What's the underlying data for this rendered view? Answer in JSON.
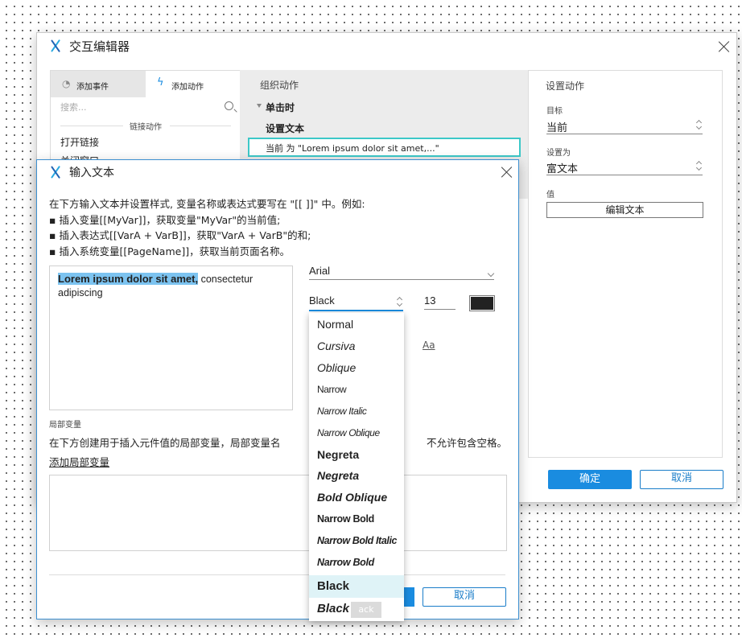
{
  "interaction_editor": {
    "title": "交互编辑器",
    "tab_add_event": "添加事件",
    "tab_add_action": "添加动作",
    "search_placeholder": "搜索...",
    "link_actions_header": "链接动作",
    "link_item_open": "打开链接",
    "link_item_close": "关闭窗口",
    "organize_header": "组织动作",
    "event_click": "单击时",
    "action_set_text": "设置文本",
    "action_detail": "当前 为 \"Lorem ipsum dolor sit amet,...\"",
    "config_header": "设置动作",
    "target_label": "目标",
    "target_value": "当前",
    "setas_label": "设置为",
    "setas_value": "富文本",
    "value_label": "值",
    "edit_text_button": "编辑文本",
    "ok_button": "确定",
    "cancel_button": "取消"
  },
  "input_text_dialog": {
    "title": "输入文本",
    "instructions": [
      "在下方输入文本并设置样式, 变量名称或表达式要写在 \"[[ ]]\" 中。例如:",
      "▪ 插入变量[[MyVar]]，获取变量\"MyVar\"的当前值;",
      "▪ 插入表达式[[VarA + VarB]]，获取\"VarA + VarB\"的和;",
      "▪ 插入系统变量[[PageName]]，获取当前页面名称。"
    ],
    "editor_selected_text": "Lorem ipsum dolor sit amet,",
    "editor_rest_text": " consectetur adipiscing",
    "font_family": "Arial",
    "font_weight": "Black",
    "font_size": "13",
    "text_color": "#222222",
    "format_icon_label": "Aa",
    "local_vars_label": "局部变量",
    "local_vars_desc_left": "在下方创建用于插入元件值的局部变量，局部变量名",
    "local_vars_desc_right": "不允许包含空格。",
    "add_local_var_link": "添加局部变量",
    "cancel_button": "取消",
    "hidden_ok_fragment": "ack"
  },
  "weight_dropdown": {
    "options": [
      "Normal",
      "Cursiva",
      "Oblique",
      "Narrow",
      "Narrow Italic",
      "Narrow Oblique",
      "Negreta",
      "Negreta",
      "Bold Oblique",
      "Narrow Bold",
      "Narrow Bold Italic",
      "Narrow Bold",
      "Black",
      "Black"
    ],
    "selected_index": 12
  },
  "colors": {
    "accent": "#1a8ce0",
    "selection_highlight": "#7cc3f0",
    "active_action_border": "#3cc8c8",
    "dropdown_hover": "#dff3f7"
  }
}
